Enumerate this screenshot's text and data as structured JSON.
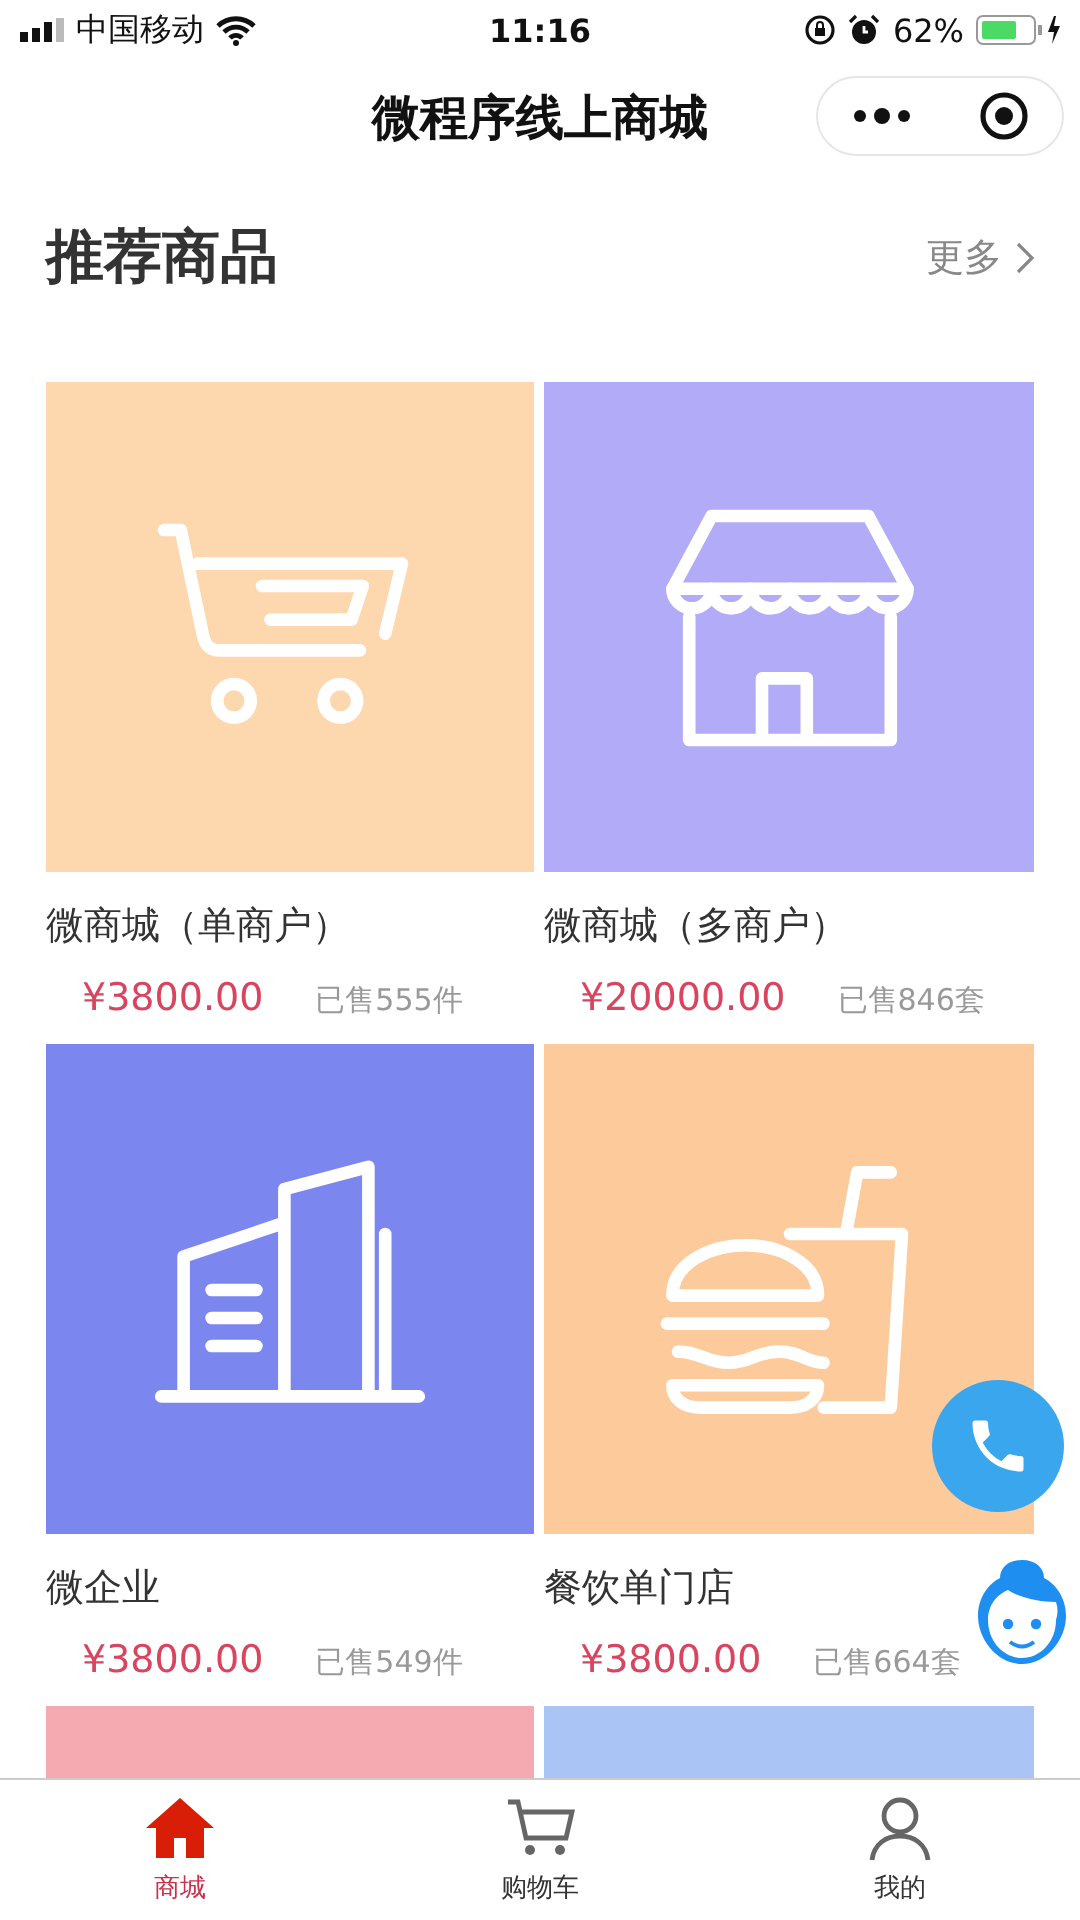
{
  "status_bar": {
    "carrier": "中国移动",
    "time": "11:16",
    "battery": "62%"
  },
  "nav": {
    "title": "微程序线上商城"
  },
  "section": {
    "title": "推荐商品",
    "more": "更多"
  },
  "products": [
    {
      "kind": "cart",
      "color": "#fdd7ad",
      "name": "微商城（单商户）",
      "price": "¥3800.00",
      "sold": "已售555件"
    },
    {
      "kind": "shop",
      "color": "#b2abf8",
      "name": "微商城（多商户）",
      "price": "¥20000.00",
      "sold": "已售846套"
    },
    {
      "kind": "building",
      "color": "#7b87ef",
      "name": "微企业",
      "price": "¥3800.00",
      "sold": "已售549件"
    },
    {
      "kind": "food",
      "color": "#fcca9b",
      "name": "餐饮单门店",
      "price": "¥3800.00",
      "sold": "已售664套"
    },
    {
      "kind": "blank",
      "color": "#f5a9b1"
    },
    {
      "kind": "blank",
      "color": "#aac4f6"
    }
  ],
  "tabbar": [
    {
      "label": "商城",
      "selected": true,
      "kind": "home"
    },
    {
      "label": "购物车",
      "selected": false,
      "kind": "cart"
    },
    {
      "label": "我的",
      "selected": false,
      "kind": "user"
    }
  ]
}
